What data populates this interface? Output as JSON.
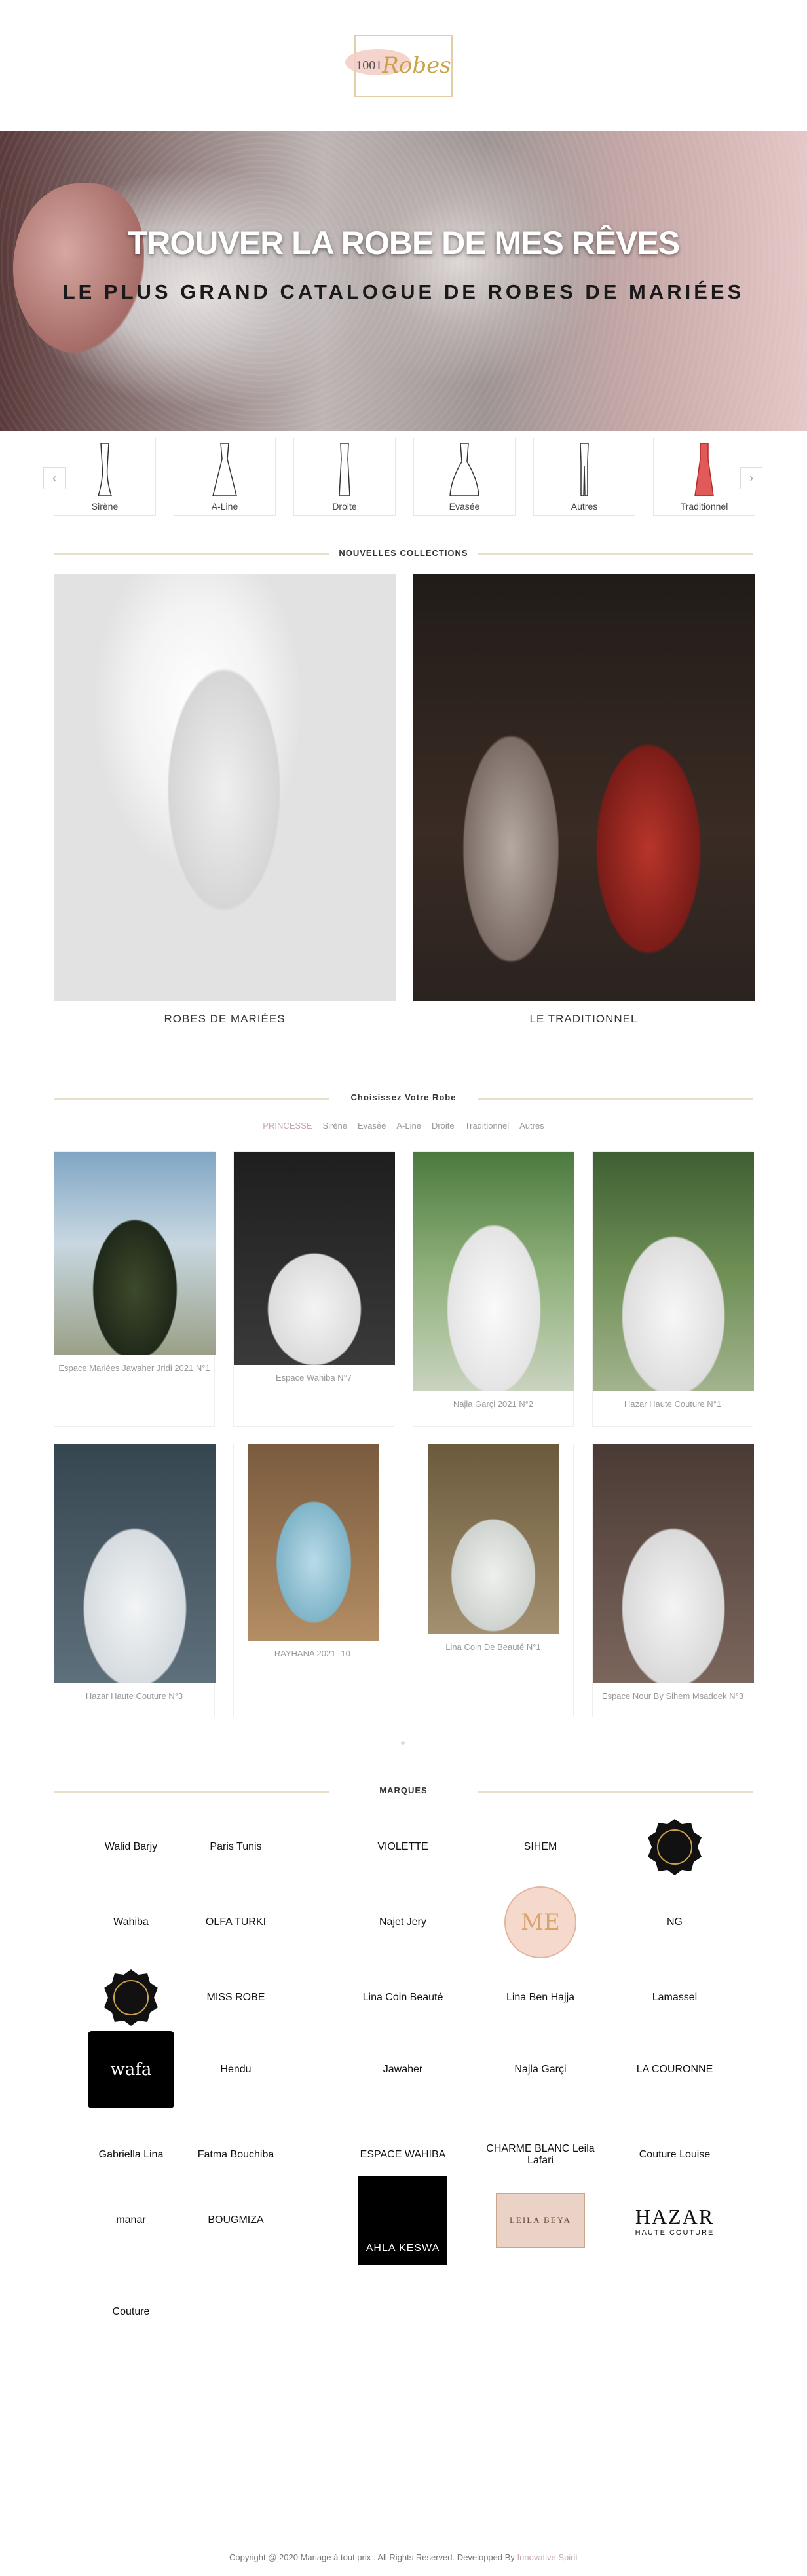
{
  "logo": {
    "num": "1001",
    "word": "Robes"
  },
  "hero": {
    "title": "TROUVER LA ROBE DE MES RÊVES",
    "subtitle": "LE PLUS GRAND CATALOGUE DE ROBES DE MARIÉES"
  },
  "carousel": {
    "prev": "‹",
    "next": "›",
    "categories": [
      "Sirène",
      "A-Line",
      "Droite",
      "Evasée",
      "Autres",
      "Traditionnel"
    ]
  },
  "sections": {
    "new_collections": "NOUVELLES COLLECTIONS",
    "choose": "Choisissez Votre Robe",
    "brands": "MARQUES"
  },
  "collections": [
    {
      "label": "ROBES DE MARIÉES"
    },
    {
      "label": "LE TRADITIONNEL"
    }
  ],
  "filters": [
    "PRINCESSE",
    "Sirène",
    "Evasée",
    "A-Line",
    "Droite",
    "Traditionnel",
    "Autres"
  ],
  "dresses": [
    {
      "title": "Espace Mariées Jawaher Jridi 2021 N°1"
    },
    {
      "title": "Espace Wahiba N°7"
    },
    {
      "title": "Najla Garçi 2021 N°2"
    },
    {
      "title": "Hazar Haute Couture N°1"
    },
    {
      "title": "Hazar Haute Couture N°3"
    },
    {
      "title": "RAYHANA 2021 -10-"
    },
    {
      "title": "Lina Coin De Beauté N°1"
    },
    {
      "title": "Espace Nour By Sihem Msaddek N°3"
    }
  ],
  "brands": [
    "Walid Barjy",
    "Paris Tunis",
    "VIOLETTE",
    "SIHEM",
    "",
    "Wahiba",
    "OLFA TURKI",
    "Najet Jery",
    "ME",
    "NG",
    "",
    "MISS ROBE",
    "Lina Coin Beauté",
    "Lina Ben Hajja",
    "Lamassel",
    "wafa",
    "Hendu",
    "Jawaher",
    "Najla Garçi",
    "LA COURONNE",
    "Gabriella Lina",
    "Fatma Bouchiba",
    "ESPACE WAHIBA",
    "CHARME BLANC Leila Lafari",
    "Couture Louise",
    "manar",
    "BOUGMIZA",
    "AHLA KESWA",
    "LEILA BEYA",
    "HAZAR",
    "Couture"
  ],
  "brand_subs": {
    "CHARME BLANC Leila Lafari": "",
    "HAZAR": "HAUTE COUTURE"
  },
  "footer": {
    "text": "Copyright @ 2020 Mariage à tout prix . All Rights Reserved. Developped By ",
    "link": "Innovative Spirit"
  }
}
